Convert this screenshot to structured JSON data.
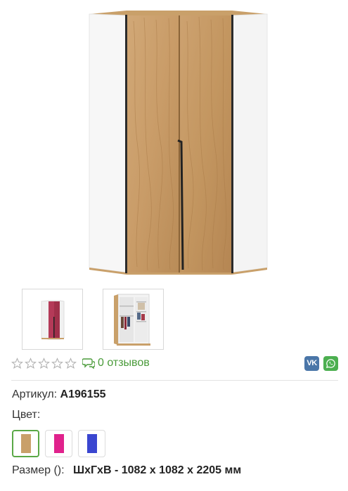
{
  "product": {
    "reviews_label": "0 отзывов",
    "stars": 0,
    "stars_total": 5,
    "article_label": "Артикул:",
    "article_value": "А196155",
    "color_label": "Цвет:",
    "size_label": "Размер ():",
    "size_value": "ШхГхВ - 1082 х 1082 х 2205 мм"
  },
  "thumbnails": [
    {
      "name": "thumb-red-wardrobe"
    },
    {
      "name": "thumb-open-wardrobe"
    }
  ],
  "swatches": [
    {
      "name": "swatch-oak",
      "color": "#c9a06a",
      "selected": true
    },
    {
      "name": "swatch-pink",
      "color": "#e0228c",
      "selected": false
    },
    {
      "name": "swatch-blue",
      "color": "#3a46d0",
      "selected": false
    }
  ],
  "social": {
    "vk_label": "VK"
  },
  "colors": {
    "accent_green": "#4a9b3a",
    "vk_blue": "#4a76a8",
    "whatsapp_green": "#4caf50",
    "oak": "#c9a06a"
  }
}
